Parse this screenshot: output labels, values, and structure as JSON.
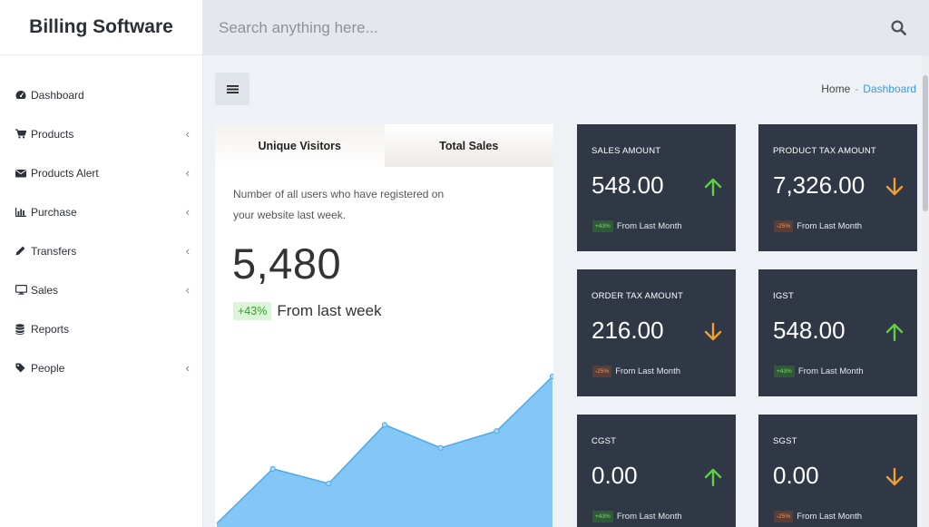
{
  "app": {
    "title": "Billing Software"
  },
  "search": {
    "placeholder": "Search anything here..."
  },
  "sidebar": {
    "items": [
      {
        "label": "Dashboard",
        "icon": "dashboard-icon",
        "has_submenu": false
      },
      {
        "label": "Products",
        "icon": "cart-icon",
        "has_submenu": true
      },
      {
        "label": "Products Alert",
        "icon": "envelope-icon",
        "has_submenu": true
      },
      {
        "label": "Purchase",
        "icon": "bar-chart-icon",
        "has_submenu": true
      },
      {
        "label": "Transfers",
        "icon": "pencil-icon",
        "has_submenu": true
      },
      {
        "label": "Sales",
        "icon": "monitor-icon",
        "has_submenu": true
      },
      {
        "label": "Reports",
        "icon": "database-icon",
        "has_submenu": false
      },
      {
        "label": "People",
        "icon": "tag-icon",
        "has_submenu": true
      }
    ]
  },
  "breadcrumb": {
    "home": "Home",
    "separator": "-",
    "current": "Dashboard"
  },
  "visitors": {
    "tabs": [
      "Unique Visitors",
      "Total Sales"
    ],
    "description": "Number of all users who have registered on your website last week.",
    "value": "5,480",
    "change": "+43%",
    "change_label": "From last week"
  },
  "chart_data": {
    "type": "area",
    "x": [
      0,
      1,
      2,
      3,
      4,
      5,
      6
    ],
    "values": [
      0,
      52,
      38,
      94,
      72,
      88,
      140
    ],
    "ylim": [
      0,
      160
    ],
    "color": "#82c7f5",
    "line_color": "#4fa9e6"
  },
  "stats": [
    {
      "title": "SALES AMOUNT",
      "value": "548.00",
      "direction": "up",
      "change": "+43%",
      "from": "From Last Month"
    },
    {
      "title": "PRODUCT TAX AMOUNT",
      "value": "7,326.00",
      "direction": "down",
      "change": "-25%",
      "from": "From Last Month"
    },
    {
      "title": "ORDER TAX AMOUNT",
      "value": "216.00",
      "direction": "down",
      "change": "-25%",
      "from": "From Last Month"
    },
    {
      "title": "IGST",
      "value": "548.00",
      "direction": "up",
      "change": "+43%",
      "from": "From Last Month"
    },
    {
      "title": "CGST",
      "value": "0.00",
      "direction": "up",
      "change": "+43%",
      "from": "From Last Month"
    },
    {
      "title": "SGST",
      "value": "0.00",
      "direction": "down",
      "change": "-25%",
      "from": "From Last Month"
    }
  ],
  "colors": {
    "up": "#5fd03f",
    "down": "#f0a02e",
    "accent": "#3a9be0",
    "card_bg": "#313845"
  }
}
